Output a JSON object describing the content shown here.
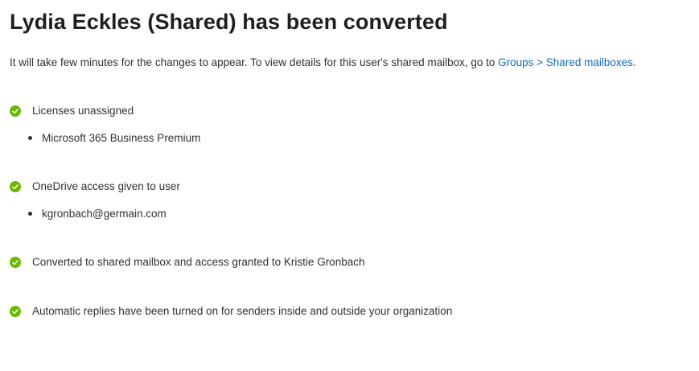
{
  "title": "Lydia Eckles (Shared) has been converted",
  "intro": {
    "text": "It will take few minutes for the changes to appear. To view details for this user's shared mailbox, go to ",
    "link_text": "Groups > Shared mailboxes",
    "suffix": "."
  },
  "status_items": [
    {
      "icon": "check-circle-icon",
      "label": "Licenses unassigned",
      "details": [
        "Microsoft 365 Business Premium"
      ]
    },
    {
      "icon": "check-circle-icon",
      "label": "OneDrive access given to user",
      "details": [
        "kgronbach@germain.com"
      ]
    },
    {
      "icon": "check-circle-icon",
      "label": "Converted to shared mailbox and access granted to Kristie Gronbach",
      "details": []
    },
    {
      "icon": "check-circle-icon",
      "label": "Automatic replies have been turned on for senders inside and outside your organization",
      "details": []
    }
  ],
  "colors": {
    "success": "#6bb700",
    "link": "#0f6cbd",
    "text": "#323130",
    "heading": "#201f1e"
  }
}
